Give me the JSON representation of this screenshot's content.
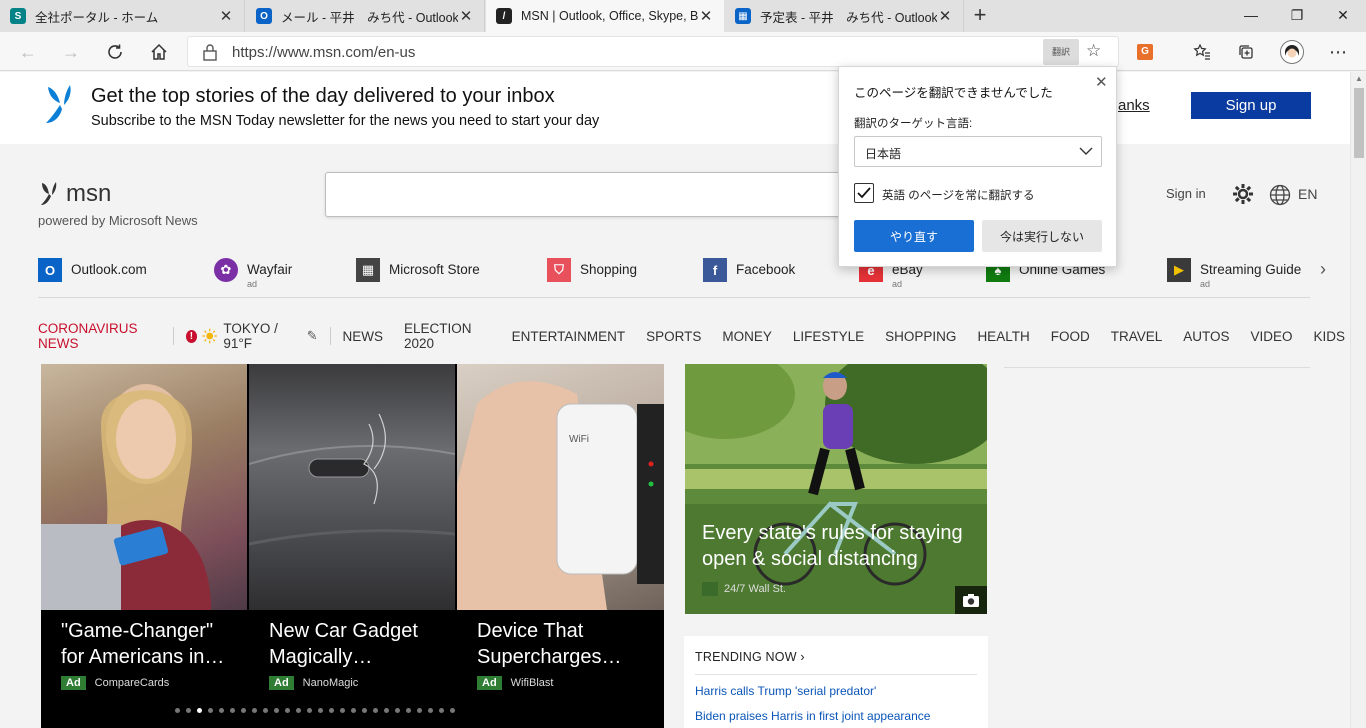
{
  "browser": {
    "tabs": [
      {
        "title": "全社ポータル - ホーム",
        "icon": "sharepoint-icon",
        "close": "✕"
      },
      {
        "title": "メール - 平井　みち代 - Outlook",
        "icon": "outlook-icon",
        "close": "✕"
      },
      {
        "title": "MSN | Outlook, Office, Skype, Bing",
        "icon": "msn-icon",
        "close": "✕"
      },
      {
        "title": "予定表 - 平井　みち代 - Outlook",
        "icon": "calendar-icon",
        "close": "✕"
      }
    ],
    "new_tab": "+",
    "window_controls": {
      "minimize": "—",
      "restore": "❐",
      "close": "✕"
    },
    "address": {
      "url": "https://www.msn.com/en-us",
      "translate_label": "翻訳"
    },
    "toolbar_icons": [
      "back-icon",
      "forward-icon",
      "refresh-icon",
      "home-icon",
      "favorites-star-icon",
      "extension-icon",
      "favorites-icon",
      "collections-icon",
      "profile-avatar-icon",
      "more-icon"
    ]
  },
  "banner": {
    "title": "Get the top stories of the day delivered to your inbox",
    "subtitle": "Subscribe to the MSN Today newsletter for the news you need to start your day",
    "thanks": "anks",
    "signup": "Sign up"
  },
  "msn": {
    "logo_text": "msn",
    "powered": "powered by Microsoft News",
    "signin": "Sign in",
    "lang": "EN"
  },
  "quicklinks": [
    {
      "label": "Outlook.com",
      "ad": "",
      "color": "#0a64c8",
      "icon": "O"
    },
    {
      "label": "Wayfair",
      "ad": "ad",
      "color": "#7b2fa5",
      "icon": "✿"
    },
    {
      "label": "Microsoft Store",
      "ad": "",
      "color": "#444444",
      "icon": "▦"
    },
    {
      "label": "Shopping",
      "ad": "",
      "color": "#e8505b",
      "icon": "⛉"
    },
    {
      "label": "Facebook",
      "ad": "",
      "color": "#3b5998",
      "icon": "f"
    },
    {
      "label": "eBay",
      "ad": "ad",
      "color": "#e53238",
      "icon": "e"
    },
    {
      "label": "Online Games",
      "ad": "",
      "color": "#107c10",
      "icon": "♠"
    },
    {
      "label": "Streaming Guide",
      "ad": "ad",
      "color": "#3a3a3a",
      "icon": "▶"
    }
  ],
  "nav": {
    "corona": "CORONAVIRUS NEWS",
    "weather": "TOKYO / 91°F",
    "items": [
      "NEWS",
      "ELECTION 2020",
      "ENTERTAINMENT",
      "SPORTS",
      "MONEY",
      "LIFESTYLE",
      "SHOPPING",
      "HEALTH",
      "FOOD",
      "TRAVEL",
      "AUTOS",
      "VIDEO",
      "KIDS"
    ]
  },
  "carousel": {
    "slides": [
      {
        "headline": "\"Game-Changer\" for Americans in…",
        "ad": "Ad",
        "source": "CompareCards"
      },
      {
        "headline": "New Car Gadget Magically…",
        "ad": "Ad",
        "source": "NanoMagic"
      },
      {
        "headline": "Device That Supercharges…",
        "ad": "Ad",
        "source": "WifiBlast"
      }
    ],
    "dot_count": 26,
    "active_dot": 2
  },
  "feature": {
    "headline": "Every state's rules for staying open & social distancing",
    "source": "24/7 Wall St."
  },
  "trending": {
    "title": "TRENDING NOW",
    "links": [
      "Harris calls Trump 'serial predator'",
      "Biden praises Harris in first joint appearance"
    ]
  },
  "translate_popup": {
    "title": "このページを翻訳できませんでした",
    "target_label": "翻訳のターゲット言語:",
    "selected_language": "日本語",
    "checkbox_label": "英語 のページを常に翻訳する",
    "checkbox_checked": true,
    "retry": "やり直す",
    "not_now": "今は実行しない"
  }
}
